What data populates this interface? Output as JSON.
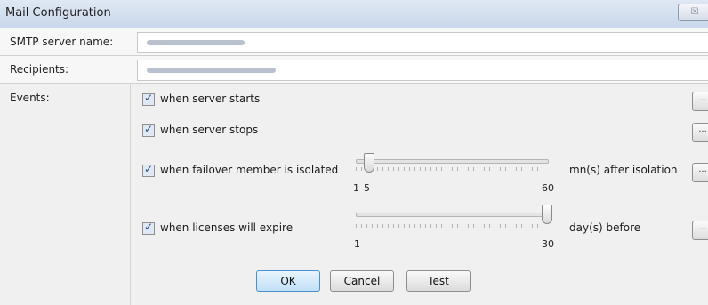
{
  "window": {
    "title": "Mail Configuration",
    "close_glyph": "☒"
  },
  "smtp": {
    "label": "SMTP server name:",
    "value": ""
  },
  "recipients": {
    "label": "Recipients:",
    "value": ""
  },
  "events": {
    "label": "Events:",
    "items": [
      {
        "label": "when server starts",
        "checked": true,
        "more": "..."
      },
      {
        "label": "when server stops",
        "checked": true,
        "more": "..."
      },
      {
        "label": "when failover member is isolated",
        "checked": true,
        "more": "...",
        "slider": {
          "min_label": "1",
          "value_label": "5",
          "max_label": "60",
          "value": 5,
          "min": 1,
          "max": 60,
          "unit": "mn(s) after isolation"
        }
      },
      {
        "label": "when licenses will expire",
        "checked": true,
        "more": "...",
        "slider": {
          "min_label": "1",
          "max_label": "30",
          "value": 30,
          "min": 1,
          "max": 30,
          "unit": "day(s) before"
        }
      }
    ]
  },
  "buttons": {
    "ok": "OK",
    "cancel": "Cancel",
    "test": "Test"
  }
}
